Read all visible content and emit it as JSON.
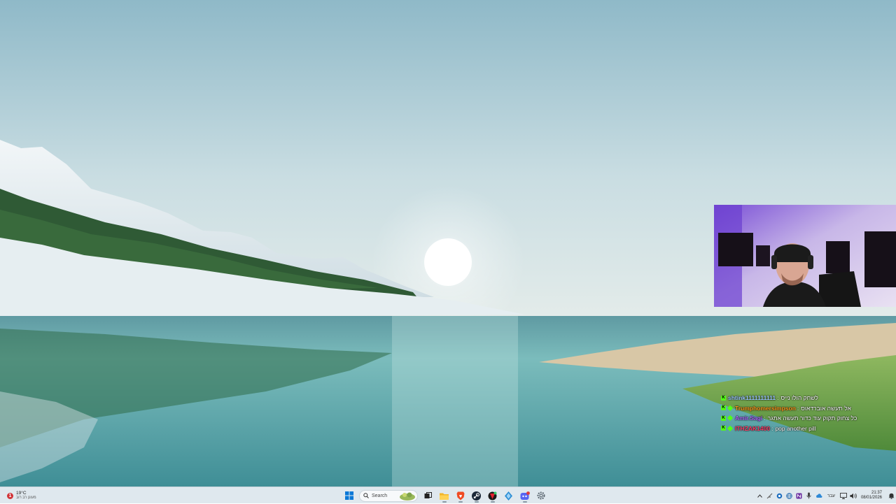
{
  "desktop": {
    "wallpaper": "Windows 11 lake landscape"
  },
  "stream_overlay": {
    "chat": [
      {
        "user": "shtink1111111111",
        "user_color": "#9ec8ff",
        "badge_color": "",
        "message": "לשחק הולו נייס"
      },
      {
        "user": "Trumphomersimpson",
        "user_color": "#ff9a1e",
        "badge_color": "#53fc18",
        "message": "אל תעשה אוברדאוס"
      },
      {
        "user": "Amir.Sagi",
        "user_color": "#b06aff",
        "badge_color": "#53fc18",
        "message": "כל צחוק תקוק עוד כדור תעשה אתגר"
      },
      {
        "user": "ITHZAK1400",
        "user_color": "#ff3d6a",
        "badge_color": "#53fc18",
        "message": "pop another pill"
      }
    ],
    "chat_separator": ":",
    "platform_badge": "K"
  },
  "taskbar": {
    "weather": {
      "temp": "19°C",
      "desc": "מעונן רב רוב",
      "alert_count": "1"
    },
    "search_placeholder": "Search",
    "pinned": [
      {
        "name": "start-button",
        "icon": "windows-logo"
      },
      {
        "name": "task-view-button",
        "icon": "task-view"
      },
      {
        "name": "file-explorer-button",
        "icon": "folder"
      },
      {
        "name": "brave-button",
        "icon": "brave-lion"
      },
      {
        "name": "steam-button",
        "icon": "steam"
      },
      {
        "name": "app-red-button",
        "icon": "red-app"
      },
      {
        "name": "app-diamond-button",
        "icon": "diamond"
      },
      {
        "name": "discord-button",
        "icon": "discord"
      },
      {
        "name": "settings-button",
        "icon": "gear"
      }
    ],
    "language": "עבר",
    "clock": {
      "time": "21:37",
      "date": "08/01/2026"
    }
  }
}
